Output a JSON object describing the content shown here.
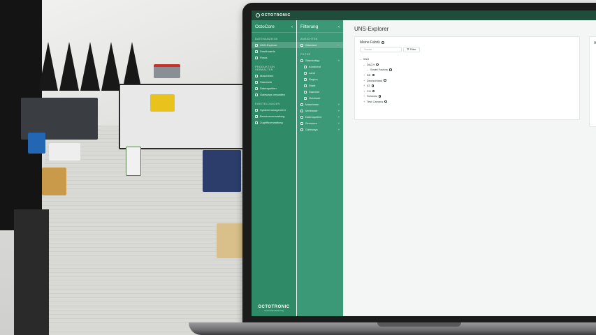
{
  "app": {
    "brand": "OCTOTRONIC",
    "brand_sub": "Smart Manufacturing"
  },
  "sidebar": {
    "title": "OctoCore",
    "sections": [
      {
        "label": "Datenanzeige",
        "items": [
          {
            "label": "UNS-Explorer",
            "active": true
          },
          {
            "label": "Dashboards",
            "active": false
          },
          {
            "label": "Flows",
            "active": false
          }
        ]
      },
      {
        "label": "Produktion verwalten",
        "items": [
          {
            "label": "Maschinen"
          },
          {
            "label": "Standorte"
          },
          {
            "label": "Datenquellen"
          },
          {
            "label": "Gateways verwalten"
          }
        ]
      },
      {
        "label": "Einstellungen",
        "items": [
          {
            "label": "Systemmanagement"
          },
          {
            "label": "Benutzerverwaltung"
          },
          {
            "label": "Zugriffsverwaltung"
          }
        ]
      }
    ]
  },
  "filter_panel": {
    "title": "Filterung",
    "sections": [
      {
        "label": "Ansichten",
        "items": [
          {
            "label": "Standard",
            "active": true
          }
        ]
      },
      {
        "label": "Filter",
        "items": [
          {
            "label": "Standorttyp",
            "expanded": true
          },
          {
            "label": "Kontinent",
            "sub": true
          },
          {
            "label": "Land",
            "sub": true
          },
          {
            "label": "Region",
            "sub": true
          },
          {
            "label": "Stadt",
            "sub": true
          },
          {
            "label": "Standort",
            "sub": true
          },
          {
            "label": "Gebäude",
            "sub": true
          },
          {
            "label": "Maschinen",
            "expanded": false
          },
          {
            "label": "Merkmale",
            "expanded": false
          },
          {
            "label": "Datenquellen",
            "expanded": false
          },
          {
            "label": "Sensoren",
            "expanded": false
          },
          {
            "label": "Gateways",
            "expanded": false
          }
        ]
      }
    ]
  },
  "main": {
    "page_title": "UNS-Explorer",
    "card_title": "Meine Fabrik",
    "search_placeholder": "Suche",
    "filter_label": "Filter",
    "side_card_label": "A",
    "tree": [
      {
        "toggle": "–",
        "label": "Welt",
        "indent": 0
      },
      {
        "toggle": "–",
        "label": "DACH",
        "indent": 1
      },
      {
        "toggle": "–",
        "label": "Smart Factory",
        "indent": 2
      },
      {
        "toggle": "+",
        "label": "DE",
        "indent": 1
      },
      {
        "toggle": "+",
        "label": "Deutschland",
        "indent": 1
      },
      {
        "toggle": "+",
        "label": "AT",
        "indent": 1
      },
      {
        "toggle": "+",
        "label": "CH",
        "indent": 1
      },
      {
        "toggle": "+",
        "label": "Schweiz",
        "indent": 1
      },
      {
        "toggle": "+",
        "label": "Test Campus",
        "indent": 1
      }
    ]
  },
  "colors": {
    "primary": "#2f8a68",
    "secondary": "#3c9977",
    "topbar": "#1f4d3c",
    "accent": "#ffffff"
  }
}
